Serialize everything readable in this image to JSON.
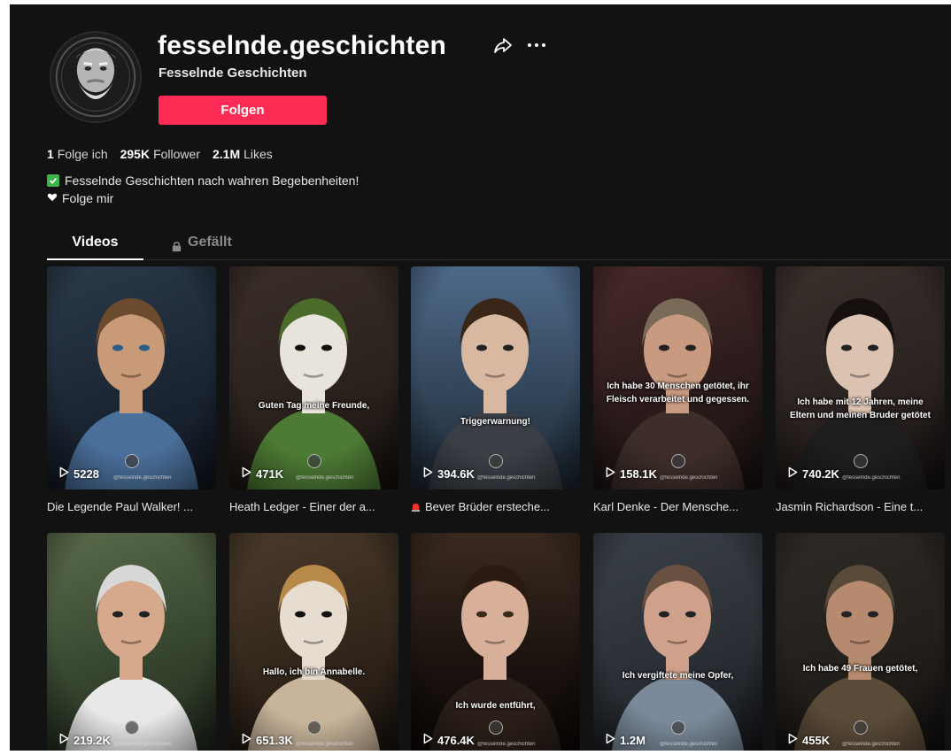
{
  "profile": {
    "username": "fesselnde.geschichten",
    "display_name": "Fesselnde Geschichten",
    "follow_label": "Folgen",
    "stats": {
      "following_num": "1",
      "following_label": "Folge ich",
      "followers_num": "295K",
      "followers_label": "Follower",
      "likes_num": "2.1M",
      "likes_label": "Likes"
    },
    "bio_line1": "Fesselnde Geschichten nach wahren Begebenheiten!",
    "bio_line2": "Folge mir"
  },
  "tabs": {
    "videos": "Videos",
    "liked": "Gefällt"
  },
  "watermark": "@fesselnde.geschichten",
  "videos": [
    {
      "views": "5228",
      "caption": "Die Legende Paul Walker! ...",
      "overlay": "",
      "theme": "paul"
    },
    {
      "views": "471K",
      "caption": "Heath Ledger - Einer der a...",
      "overlay": "Guten Tag meine Freunde,",
      "theme": "joker"
    },
    {
      "views": "394.6K",
      "caption": "Bever Brüder ersteche...",
      "overlay": "Triggerwarnung!",
      "theme": "boy"
    },
    {
      "views": "158.1K",
      "caption": "Karl Denke - Der Mensche...",
      "overlay": "Ich habe 30 Menschen getötet, ihr Fleisch verarbeitet und gegessen.",
      "theme": "karl"
    },
    {
      "views": "740.2K",
      "caption": "Jasmin Richardson - Eine t...",
      "overlay": "Ich habe mit 12 Jahren, meine Eltern und meinen Bruder getötet",
      "theme": "jasmin"
    },
    {
      "views": "219.2K",
      "caption": "",
      "overlay": "",
      "theme": "doctor"
    },
    {
      "views": "651.3K",
      "caption": "",
      "overlay": "Hallo, ich bin Annabelle.",
      "theme": "doll"
    },
    {
      "views": "476.4K",
      "caption": "",
      "overlay": "Ich wurde entführt,",
      "theme": "girl"
    },
    {
      "views": "1.2M",
      "caption": "",
      "overlay": "Ich vergiftete meine Opfer,",
      "theme": "oldwoman"
    },
    {
      "views": "455K",
      "caption": "",
      "overlay": "Ich habe 49 Frauen getötet,",
      "theme": "man"
    }
  ]
}
